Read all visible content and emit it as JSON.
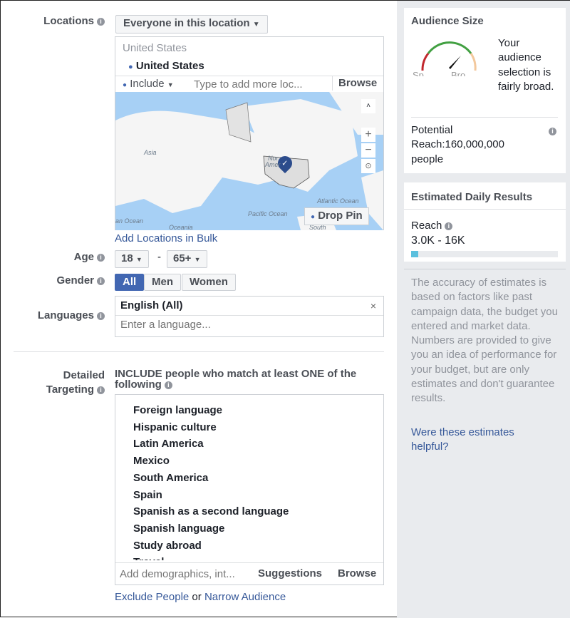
{
  "locations": {
    "label": "Locations",
    "type_select": "Everyone in this location",
    "group_title": "United States",
    "selected": "United States",
    "include_label": "Include",
    "input_placeholder": "Type to add more loc...",
    "browse": "Browse",
    "drop_pin": "Drop Pin",
    "add_bulk": "Add Locations in Bulk",
    "map_labels": {
      "asia": "Asia",
      "north": "Nor",
      "america": "Amer",
      "atlantic": "Atlantic Ocean",
      "pacific": "Pacific Ocean",
      "oceania": "Oceania",
      "south": "South",
      "indian": "an Ocean"
    }
  },
  "age": {
    "label": "Age",
    "min": "18",
    "sep": "-",
    "max": "65+"
  },
  "gender": {
    "label": "Gender",
    "options": [
      "All",
      "Men",
      "Women"
    ],
    "selected": "All"
  },
  "languages": {
    "label": "Languages",
    "selected": "English (All)",
    "placeholder": "Enter a language..."
  },
  "detailed": {
    "label1": "Detailed",
    "label2": "Targeting",
    "heading": "INCLUDE people who match at least ONE of the following",
    "items": [
      "Foreign language",
      "Hispanic culture",
      "Latin America",
      "Mexico",
      "South America",
      "Spain",
      "Spanish as a second language",
      "Spanish language",
      "Study abroad",
      "Travel"
    ],
    "placeholder": "Add demographics, int...",
    "suggestions": "Suggestions",
    "browse": "Browse",
    "exclude": "Exclude People",
    "or": "or",
    "narrow": "Narrow Audience"
  },
  "audience": {
    "title": "Audience Size",
    "gauge_left": "Sp",
    "gauge_right": "Bro",
    "description": "Your audience selection is fairly broad.",
    "reach_line1": "Potential",
    "reach_line2": "Reach:160,000,000",
    "reach_line3": "people"
  },
  "estimates": {
    "title": "Estimated Daily Results",
    "reach_label": "Reach",
    "reach_range": "3.0K - 16K",
    "bar_fill_percent": 5,
    "note": "The accuracy of estimates is based on factors like past campaign data, the budget you entered and market data. Numbers are provided to give you an idea of performance for your budget, but are only estimates and don't guarantee results.",
    "helpful": "Were these estimates helpful?"
  },
  "colors": {
    "accent": "#4267b2",
    "link": "#365899",
    "bar": "#5bc0de"
  }
}
